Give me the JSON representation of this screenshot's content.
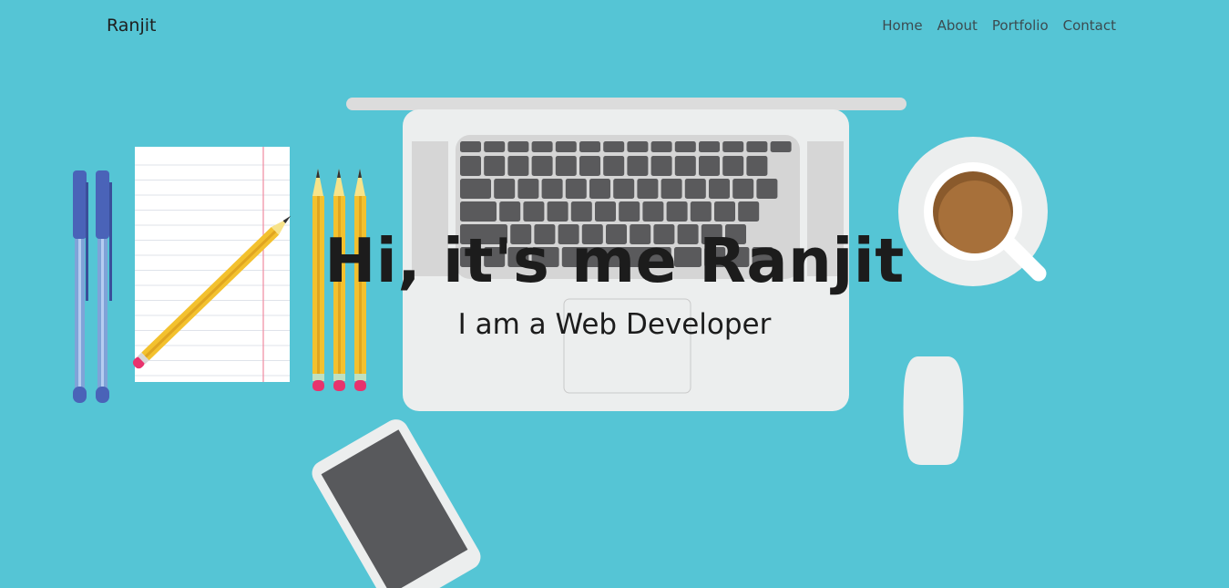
{
  "navbar": {
    "brand": "Ranjit",
    "links": [
      {
        "label": "Home"
      },
      {
        "label": "About"
      },
      {
        "label": "Portfolio"
      },
      {
        "label": "Contact"
      }
    ]
  },
  "hero": {
    "title": "Hi, it's me Ranjit",
    "subtitle": "I am a Web Developer"
  },
  "colors": {
    "background": "#55c5d5",
    "laptop": "#eceeee",
    "keys": "#5a5a5c",
    "pencil": "#f3c12e",
    "pen": "#4a63b8",
    "coffee": "#a7703a",
    "eraser": "#e8336d"
  },
  "icons": [
    "laptop-icon",
    "notepad-icon",
    "pen-icon",
    "pencil-icon",
    "coffee-cup-icon",
    "mouse-icon",
    "phone-icon"
  ]
}
